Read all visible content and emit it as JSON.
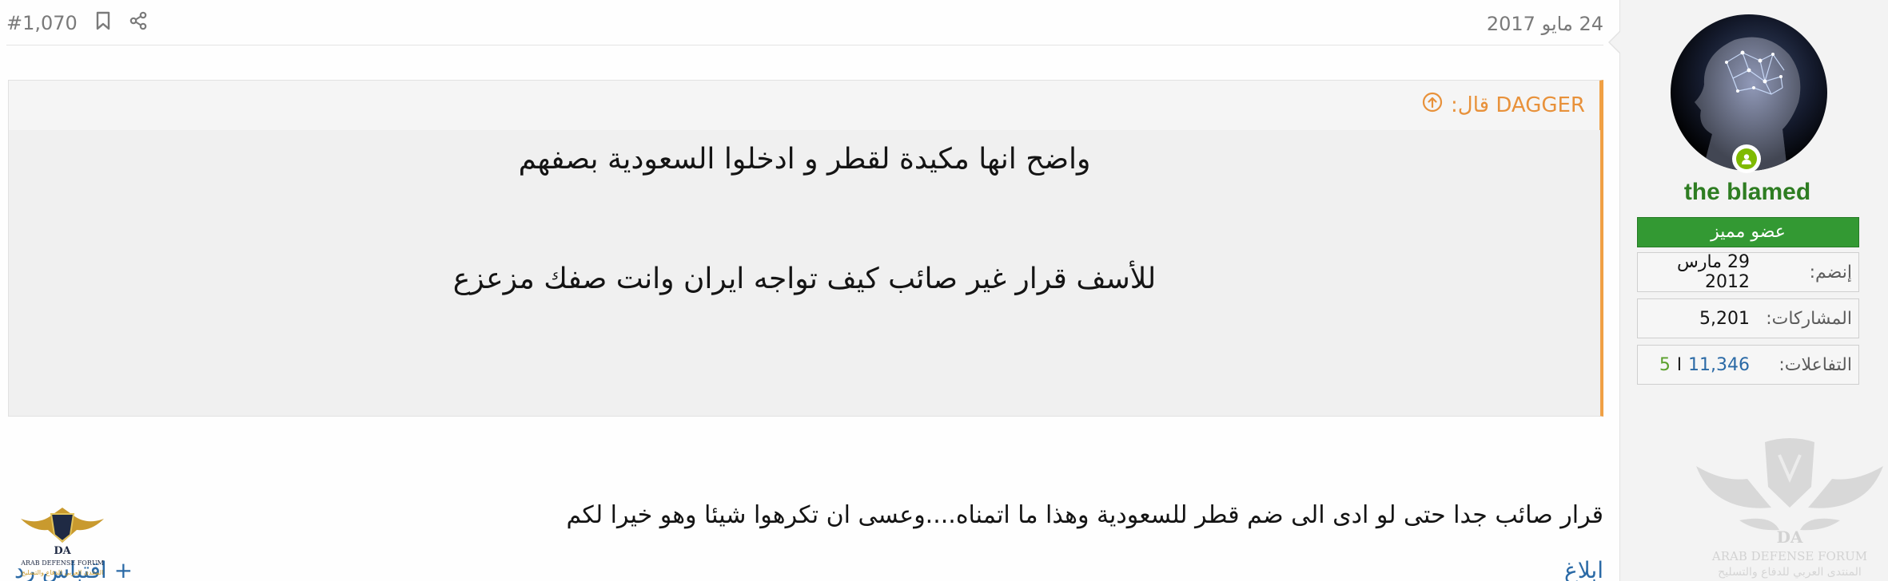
{
  "post": {
    "date": "24 مايو 2017",
    "number": "#1,070",
    "quote": {
      "author_label": "DAGGER قال:",
      "lines": [
        "واضح انها مكيدة لقطر و ادخلوا السعودية بصفهم",
        "للأسف قرار غير صائب كيف تواجه ايران وانت صفك مزعزع"
      ]
    },
    "message": "قرار صائب جدا حتى لو ادى الى ضم قطر للسعودية وهذا ما اتمناه....وعسى ان تكرهوا شيئا وهو خيرا لكم",
    "footer": {
      "report": "ابلاغ",
      "reply": "+ اقتباس",
      "reply_tail": "رد"
    }
  },
  "user": {
    "name": "the blamed",
    "title": "عضو مميز",
    "joined_label": "إنضم:",
    "joined_value": "29 مارس 2012",
    "posts_label": "المشاركات:",
    "posts_value": "5,201",
    "reactions_label": "التفاعلات:",
    "reactions_value": "11,346",
    "reactions_sep": "ا",
    "reactions_secondary": "5"
  },
  "watermark": {
    "title": "ARAB DEFENSE FORUM",
    "subtitle": "المنتدى العربي للدفاع والتسليح",
    "monogram": "DA"
  },
  "colors": {
    "accent_orange": "#f0a044",
    "username_green": "#2e7d22",
    "badge_green": "#339933",
    "link_blue": "#2b6aa6"
  }
}
